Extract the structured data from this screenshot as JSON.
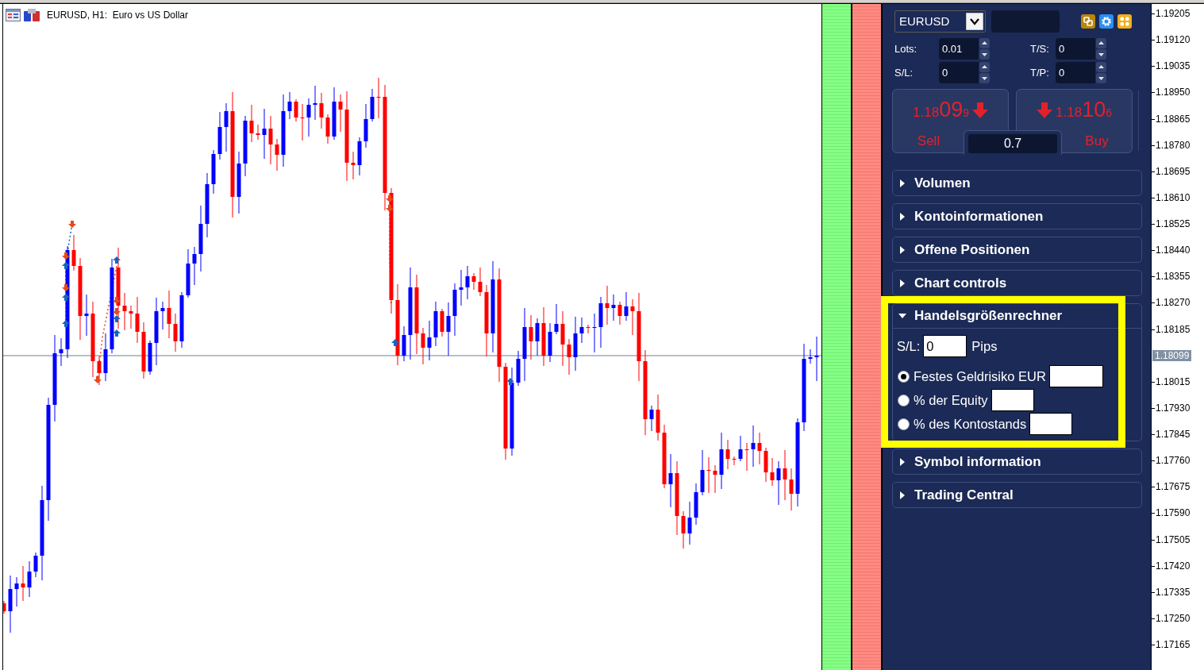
{
  "chart": {
    "title": "EURUSD, H1:  Euro vs US Dollar",
    "price_labels": [
      {
        "text": "1.19205",
        "kind": "tick"
      },
      {
        "text": "1.19120",
        "kind": "tick"
      },
      {
        "text": "1.19035",
        "kind": "tick"
      },
      {
        "text": "1.18950",
        "kind": "tick"
      },
      {
        "text": "1.18865",
        "kind": "tick"
      },
      {
        "text": "1.18780",
        "kind": "tick"
      },
      {
        "text": "1.18695",
        "kind": "tick"
      },
      {
        "text": "1.18610",
        "kind": "tick"
      },
      {
        "text": "1.18525",
        "kind": "tick"
      },
      {
        "text": "1.18440",
        "kind": "tick"
      },
      {
        "text": "1.18355",
        "kind": "tick"
      },
      {
        "text": "1.18270",
        "kind": "tick"
      },
      {
        "text": "1.18185",
        "kind": "tick"
      },
      {
        "text": "1.18099",
        "kind": "current"
      },
      {
        "text": "1.18015",
        "kind": "tick"
      },
      {
        "text": "1.17930",
        "kind": "tick"
      },
      {
        "text": "1.17845",
        "kind": "tick"
      },
      {
        "text": "1.17760",
        "kind": "tick"
      },
      {
        "text": "1.17675",
        "kind": "tick"
      },
      {
        "text": "1.17590",
        "kind": "tick"
      },
      {
        "text": "1.17505",
        "kind": "tick"
      },
      {
        "text": "1.17420",
        "kind": "tick"
      },
      {
        "text": "1.17335",
        "kind": "tick"
      },
      {
        "text": "1.17250",
        "kind": "tick"
      },
      {
        "text": "1.17165",
        "kind": "tick"
      }
    ]
  },
  "trade_panel": {
    "symbol": "EURUSD",
    "order_fields": [
      {
        "label": "Lots:",
        "value": "0.01"
      },
      {
        "label": "T/S:",
        "value": "0"
      },
      {
        "label": "S/L:",
        "value": "0"
      },
      {
        "label": "T/P:",
        "value": "0"
      }
    ],
    "sell": {
      "price_main": "1.18",
      "price_pips": "09",
      "price_point": "9",
      "label": "Sell"
    },
    "volume": "0.7",
    "buy": {
      "price_main": "1.18",
      "price_pips": "10",
      "price_point": "6",
      "label": "Buy"
    },
    "sections": [
      {
        "title": "Volumen",
        "expanded": false,
        "highlighted": false
      },
      {
        "title": "Kontoinformationen",
        "expanded": false,
        "highlighted": false
      },
      {
        "title": "Offene Positionen",
        "expanded": false,
        "highlighted": false
      },
      {
        "title": "Chart controls",
        "expanded": false,
        "highlighted": false
      },
      {
        "title": "Handelsgrößenrechner",
        "expanded": true,
        "highlighted": true,
        "body": {
          "sl_label": "S/L:",
          "sl_value": "0",
          "sl_unit": "Pips",
          "risk_options": [
            {
              "label": "Festes Geldrisiko EUR",
              "selected": true
            },
            {
              "label": "% der Equity",
              "selected": false
            },
            {
              "label": "% des Kontostands",
              "selected": false
            }
          ]
        }
      },
      {
        "title": "Symbol information",
        "expanded": false,
        "highlighted": false
      },
      {
        "title": "Trading Central",
        "expanded": false,
        "highlighted": false
      }
    ]
  }
}
